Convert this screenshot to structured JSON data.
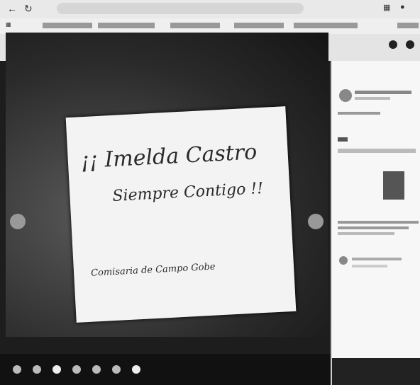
{
  "sign": {
    "line1": "¡¡ Imelda Castro",
    "line2": "Siempre Contigo !!",
    "line3": "Comisaria de Campo Gobe"
  },
  "icons": [
    "back-icon",
    "reload-icon",
    "facebook-icon",
    "close-icon",
    "next-arrow-icon",
    "prev-arrow-icon",
    "fullscreen-icon"
  ]
}
